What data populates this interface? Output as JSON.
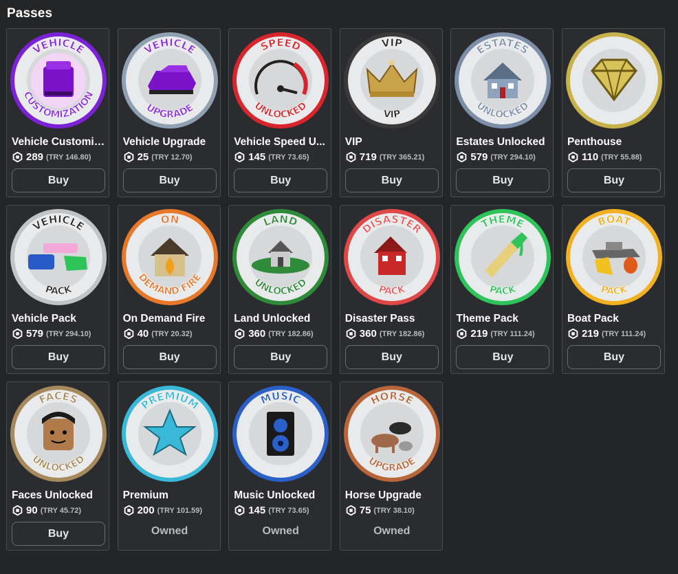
{
  "section_title": "Passes",
  "currency_icon": "robux-icon",
  "passes": [
    {
      "name": "Vehicle Customiz...",
      "price": "289",
      "local": "(TRY 146.80)",
      "action": "Buy",
      "icon": "vehicle-customization-icon",
      "top": "VEHICLE",
      "bottom": "CUSTOMIZATION",
      "ring": "#7b22d6",
      "text_color": "#8a2be2"
    },
    {
      "name": "Vehicle Upgrade",
      "price": "25",
      "local": "(TRY 12.70)",
      "action": "Buy",
      "icon": "vehicle-upgrade-icon",
      "top": "VEHICLE",
      "bottom": "UPGRADE",
      "ring": "#8fa0b0",
      "text_color": "#8a2be2"
    },
    {
      "name": "Vehicle Speed U...",
      "price": "145",
      "local": "(TRY 73.65)",
      "action": "Buy",
      "icon": "speedometer-icon",
      "top": "SPEED",
      "bottom": "UNLOCKED",
      "ring": "#d8262c",
      "text_color": "#d8262c"
    },
    {
      "name": "VIP",
      "price": "719",
      "local": "(TRY 365.21)",
      "action": "Buy",
      "icon": "crown-icon",
      "top": "VIP",
      "bottom": "VIP",
      "ring": "#3a3a3a",
      "text_color": "#222222"
    },
    {
      "name": "Estates Unlocked",
      "price": "579",
      "local": "(TRY 294.10)",
      "action": "Buy",
      "icon": "house-icon",
      "top": "ESTATES",
      "bottom": "UNLOCKED",
      "ring": "#7d8fa8",
      "text_color": "#7d8fa8"
    },
    {
      "name": "Penthouse",
      "price": "110",
      "local": "(TRY 55.88)",
      "action": "Buy",
      "icon": "diamond-icon",
      "top": "",
      "bottom": "",
      "ring": "#c7b24a",
      "text_color": "#c7b24a"
    },
    {
      "name": "Vehicle Pack",
      "price": "579",
      "local": "(TRY 294.10)",
      "action": "Buy",
      "icon": "vehicle-pack-icon",
      "top": "VEHICLE",
      "bottom": "PACK",
      "ring": "#bfc4c8",
      "text_color": "#2a2a2a"
    },
    {
      "name": "On Demand Fire",
      "price": "40",
      "local": "(TRY 20.32)",
      "action": "Buy",
      "icon": "burning-house-icon",
      "top": "ON",
      "bottom": "DEMAND FIRE",
      "ring": "#e6782a",
      "text_color": "#e6782a"
    },
    {
      "name": "Land Unlocked",
      "price": "360",
      "local": "(TRY 182.86)",
      "action": "Buy",
      "icon": "land-icon",
      "top": "LAND",
      "bottom": "UNLOCKED",
      "ring": "#2f8a3a",
      "text_color": "#2f8a3a"
    },
    {
      "name": "Disaster Pass",
      "price": "360",
      "local": "(TRY 182.86)",
      "action": "Buy",
      "icon": "disaster-house-icon",
      "top": "DISASTER",
      "bottom": "PACK",
      "ring": "#e04848",
      "text_color": "#e85a5a"
    },
    {
      "name": "Theme Pack",
      "price": "219",
      "local": "(TRY 111.24)",
      "action": "Buy",
      "icon": "paintbrush-icon",
      "top": "THEME",
      "bottom": "PACK",
      "ring": "#2ec45a",
      "text_color": "#2ec45a"
    },
    {
      "name": "Boat Pack",
      "price": "219",
      "local": "(TRY 111.24)",
      "action": "Buy",
      "icon": "boat-icon",
      "top": "BOAT",
      "bottom": "PACK",
      "ring": "#f0b020",
      "text_color": "#f0b020"
    },
    {
      "name": "Faces Unlocked",
      "price": "90",
      "local": "(TRY 45.72)",
      "action": "Buy",
      "icon": "face-icon",
      "top": "FACES",
      "bottom": "UNLOCKED",
      "ring": "#a68a5c",
      "text_color": "#a68a5c"
    },
    {
      "name": "Premium",
      "price": "200",
      "local": "(TRY 101.59)",
      "action": "Owned",
      "icon": "star-icon",
      "top": "PREMIUM",
      "bottom": "",
      "ring": "#3ab8d8",
      "text_color": "#3ab8d8"
    },
    {
      "name": "Music Unlocked",
      "price": "145",
      "local": "(TRY 73.65)",
      "action": "Owned",
      "icon": "speaker-icon",
      "top": "MUSIC",
      "bottom": "",
      "ring": "#2a60c8",
      "text_color": "#2a60c8"
    },
    {
      "name": "Horse Upgrade",
      "price": "75",
      "local": "(TRY 38.10)",
      "action": "Owned",
      "icon": "horse-icon",
      "top": "HORSE",
      "bottom": "UPGRADE",
      "ring": "#b8653a",
      "text_color": "#b8653a"
    }
  ]
}
